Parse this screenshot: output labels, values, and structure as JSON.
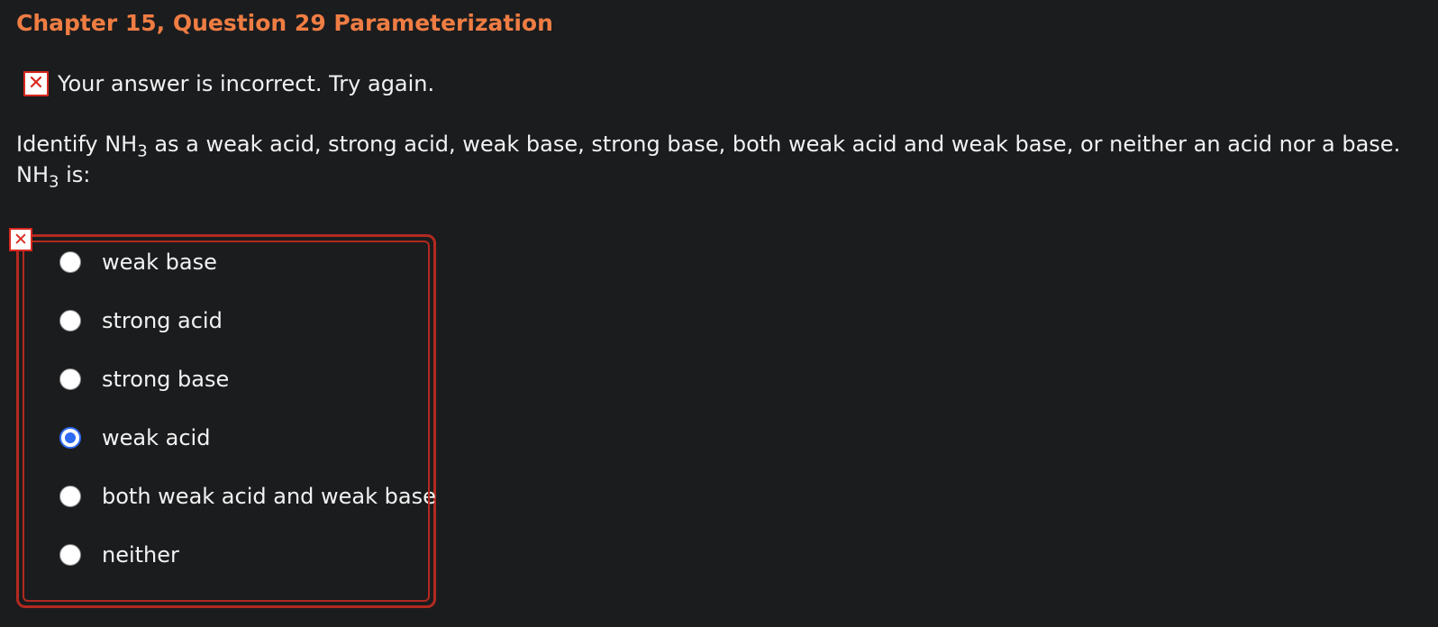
{
  "page": {
    "title": "Chapter 15, Question 29 Parameterization"
  },
  "feedback": {
    "icon": "incorrect-x-icon",
    "icon_glyph": "✕",
    "text": "Your answer is incorrect.  Try again."
  },
  "question": {
    "line1_pre": "Identify NH",
    "line1_sub": "3",
    "line1_post": " as a weak acid, strong acid, weak base, strong base, both weak acid and weak base, or neither an acid nor a base.",
    "line2_pre": "NH",
    "line2_sub": "3",
    "line2_post": " is:"
  },
  "choices": {
    "error_icon_glyph": "✕",
    "selected_index": 3,
    "items": [
      {
        "label": "weak base"
      },
      {
        "label": "strong acid"
      },
      {
        "label": "strong base"
      },
      {
        "label": "weak acid"
      },
      {
        "label": "both weak acid and weak base"
      },
      {
        "label": "neither"
      }
    ]
  },
  "colors": {
    "background": "#1b1c1e",
    "title": "#ef7d43",
    "error": "#d8281f",
    "error_border": "#b22a20",
    "radio_selected": "#2f6bf2",
    "text": "#f2f2f2"
  }
}
